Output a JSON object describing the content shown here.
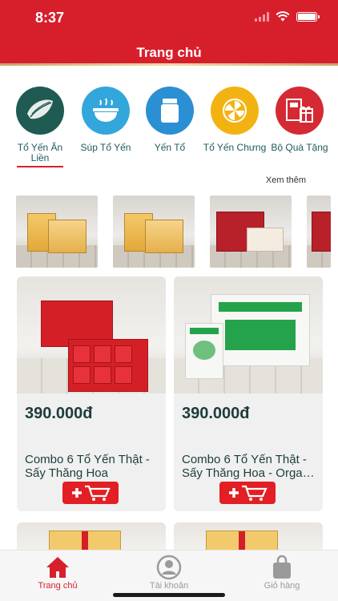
{
  "status_bar": {
    "time": "8:37"
  },
  "header": {
    "title": "Trang chủ",
    "color": "#d71f2b"
  },
  "categories": [
    {
      "label": "Tổ Yến Ăn Liền",
      "icon": "bird-nest-icon",
      "color": "#1f5b52",
      "active": true
    },
    {
      "label": "Súp Tổ Yến",
      "icon": "soup-bowl-icon",
      "color": "#33a6dc",
      "active": false
    },
    {
      "label": "Yến Tổ",
      "icon": "jar-icon",
      "color": "#2b8fd4",
      "active": false
    },
    {
      "label": "Tổ Yến Chưng",
      "icon": "swirl-icon",
      "color": "#f2b312",
      "active": false
    },
    {
      "label": "Bộ Quà Tặng",
      "icon": "gift-box-icon",
      "color": "#d52a34",
      "active": false
    }
  ],
  "see_more": "Xem thêm",
  "products": [
    {
      "price": "390.000đ",
      "name_line1": "Combo 6 Tổ Yến Thật -",
      "name_line2": "Sấy Thăng Hoa"
    },
    {
      "price": "390.000đ",
      "name_line1": "Combo 6 Tổ Yến Thật -",
      "name_line2": "Sấy Thăng Hoa - Organi..."
    }
  ],
  "bottom_nav": [
    {
      "label": "Trang chủ",
      "icon": "home-icon",
      "active": true
    },
    {
      "label": "Tài khoản",
      "icon": "account-icon",
      "active": false
    },
    {
      "label": "Giỏ hàng",
      "icon": "shopping-bag-icon",
      "active": false
    }
  ]
}
